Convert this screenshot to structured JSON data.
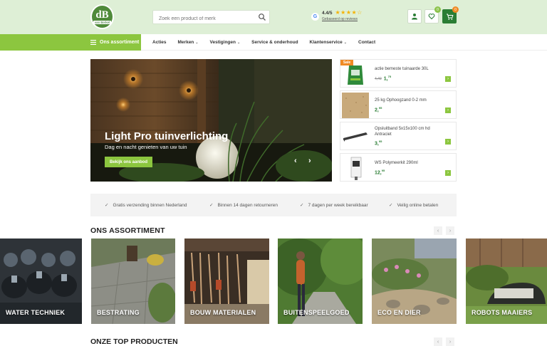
{
  "header": {
    "logo_text": "dB",
    "logo_sub": "van Berkel",
    "search_placeholder": "Zoek een product of merk",
    "rating_score": "4.4/5",
    "rating_stars": 4.4,
    "rating_link": "Gebaseerd op reviews",
    "wishlist_count": "0",
    "cart_count": "0",
    "colors": {
      "header_bg": "#deefd6",
      "accent": "#8cc63f",
      "dark_green": "#2a7d34"
    }
  },
  "nav": {
    "assortment_label": "Ons assortiment",
    "items": [
      {
        "label": "Acties",
        "dropdown": false
      },
      {
        "label": "Merken",
        "dropdown": true
      },
      {
        "label": "Vestigingen",
        "dropdown": true
      },
      {
        "label": "Service & onderhoud",
        "dropdown": false
      },
      {
        "label": "Klantenservice",
        "dropdown": true
      },
      {
        "label": "Contact",
        "dropdown": false
      }
    ]
  },
  "hero": {
    "title": "Light Pro tuinverlichting",
    "subtitle": "Dag en nacht genieten van uw tuin",
    "button": "Bekijk ons aanbod",
    "prev": "‹",
    "next": "›"
  },
  "products": [
    {
      "name": "actie bemeste tuinaarde 30L",
      "old_price": "4,49",
      "price_int": "1",
      "price_dec": "75",
      "sale": "Sale"
    },
    {
      "name": "25 kg Ophoogzand 0-2 mm",
      "old_price": "",
      "price_int": "2",
      "price_dec": "95",
      "sale": ""
    },
    {
      "name": "Opsluitband 5x15x100 cm hd Antraciet",
      "old_price": "",
      "price_int": "3",
      "price_dec": "95",
      "sale": ""
    },
    {
      "name": "WS Polymeerkit 290ml",
      "old_price": "",
      "price_int": "12",
      "price_dec": "95",
      "sale": ""
    }
  ],
  "usps": [
    "Gratis verzending binnen Nederland",
    "Binnen 14 dagen retourneren",
    "7 dagen per week bereikbaar",
    "Veilig online betalen"
  ],
  "assortment": {
    "title": "ONS ASSORTIMENT",
    "categories": [
      "WATER TECHNIEK",
      "BESTRATING",
      "BOUW MATERIALEN",
      "BUITENSPEELGOED",
      "ECO EN DIER",
      "ROBOTS MAAIERS"
    ]
  },
  "top_products": {
    "title": "ONZE TOP PRODUCTEN"
  }
}
